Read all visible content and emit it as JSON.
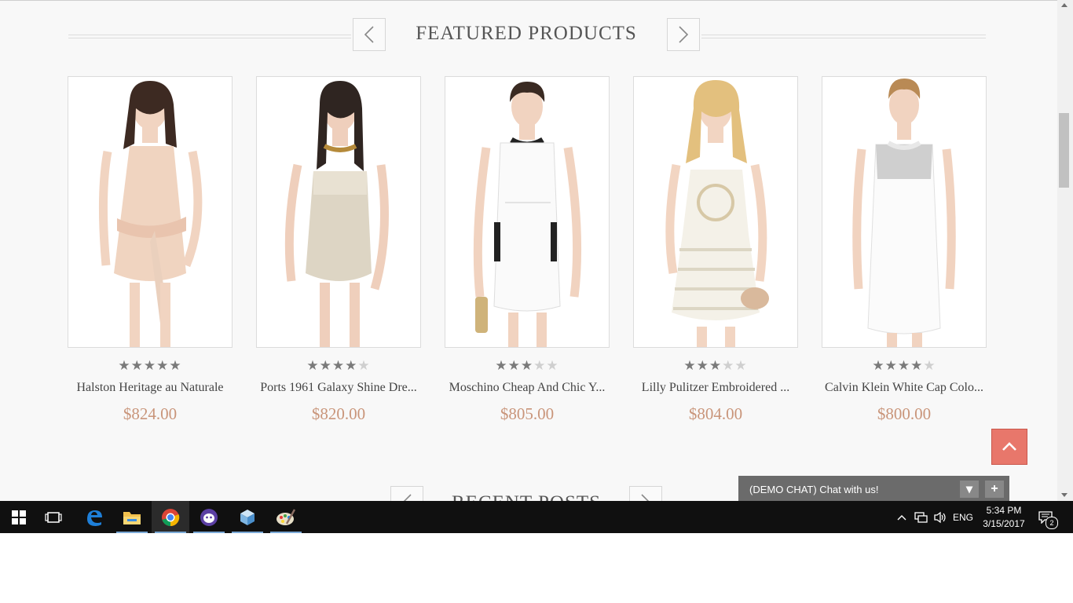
{
  "featured": {
    "title": "FEATURED PRODUCTS",
    "products": [
      {
        "name": "Halston Heritage au Naturale",
        "price": "$824.00",
        "rating": 5
      },
      {
        "name": "Ports 1961 Galaxy Shine Dre...",
        "price": "$820.00",
        "rating": 4
      },
      {
        "name": "Moschino Cheap And Chic Y...",
        "price": "$805.00",
        "rating": 3
      },
      {
        "name": "Lilly Pulitzer Embroidered ...",
        "price": "$804.00",
        "rating": 3
      },
      {
        "name": "Calvin Klein White Cap Colo...",
        "price": "$800.00",
        "rating": 4
      }
    ]
  },
  "recent_posts": {
    "title": "RECENT POSTS"
  },
  "chat": {
    "label": "(DEMO CHAT) Chat with us!",
    "minimize": "▾",
    "expand": "+"
  },
  "taskbar": {
    "apps": [
      "windows-start",
      "task-view",
      "edge",
      "file-explorer",
      "chrome",
      "app-purple",
      "app-cube",
      "paint"
    ],
    "language": "ENG",
    "time": "5:34 PM",
    "date": "3/15/2017",
    "notifications": "2"
  },
  "colors": {
    "price": "#c9957a",
    "scroll_top": "#e8776b",
    "taskbar": "#101010"
  }
}
